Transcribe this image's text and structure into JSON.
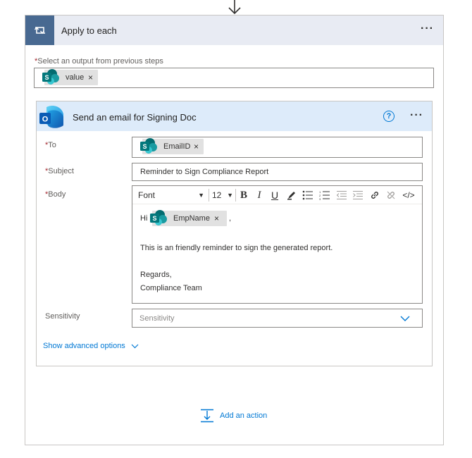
{
  "outer": {
    "title": "Apply to each",
    "more": "···",
    "select_label": "Select an output from previous steps",
    "required_mark": "*",
    "token": {
      "label": "value",
      "remove": "×"
    }
  },
  "action": {
    "title": "Send an email for Signing Doc",
    "help": "?",
    "more": "···",
    "to": {
      "label": "To",
      "token": "EmailID",
      "remove": "×"
    },
    "subject": {
      "label": "Subject",
      "value": "Reminder to Sign Compliance Report"
    },
    "body": {
      "label": "Body",
      "toolbar": {
        "font": "Font",
        "size": "12"
      },
      "greeting": "Hi",
      "token": "EmpName",
      "remove": "×",
      "trailing": ",",
      "line1": "This is an friendly reminder to sign the generated report.",
      "line2": "Regards,",
      "line3": "Compliance Team"
    },
    "sensitivity": {
      "label": "Sensitivity",
      "placeholder": "Sensitivity"
    },
    "advanced": "Show advanced options"
  },
  "add_action": "Add an action",
  "colors": {
    "loop_tile": "#486991",
    "outer_header": "#e8ebf3",
    "inner_header": "#ddebfa",
    "accent": "#0078d4",
    "required": "#a4262c"
  },
  "icons": [
    "down-arrow-icon",
    "loop-icon",
    "sharepoint-icon",
    "outlook-icon",
    "help-icon",
    "chevron-down-icon",
    "add-action-icon"
  ]
}
